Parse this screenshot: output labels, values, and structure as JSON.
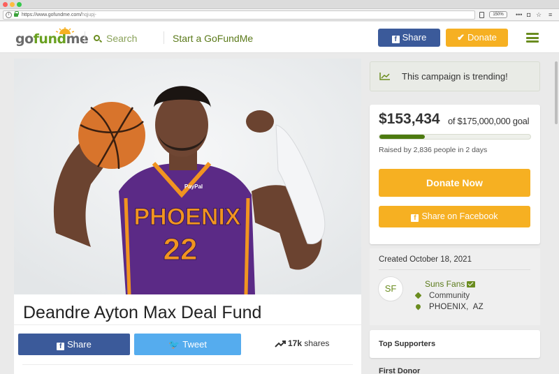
{
  "browser": {
    "url_host": "https://www.gofundme.com/",
    "url_path": "hqjupj-",
    "zoom": "150%",
    "icons": {
      "info": "info-icon",
      "lock": "lock-icon",
      "reader": "reader-view-icon",
      "more": "more-icon",
      "pocket": "pocket-icon",
      "bookmark": "star-icon",
      "menu": "hamburger-icon"
    }
  },
  "header": {
    "logo": {
      "go": "go",
      "fund": "fund",
      "me": "me"
    },
    "search_label": "Search",
    "start_label": "Start a GoFundMe",
    "share_label": "Share",
    "donate_label": "Donate",
    "colors": {
      "brand_green": "#6a8c1f",
      "facebook_blue": "#3b5a9a",
      "donate_yellow": "#f6b022"
    }
  },
  "campaign": {
    "title": "Deandre Ayton Max Deal Fund",
    "photo": {
      "jersey_team": "PHOENIX",
      "jersey_number": "22",
      "jersey_sponsor": "PayPal"
    },
    "share_fb_label": "Share",
    "tweet_label": "Tweet",
    "shares_count": "17k",
    "shares_label": "shares",
    "colors": {
      "twitter_blue": "#55acee"
    }
  },
  "sidebar": {
    "trending_text": "This campaign is trending!",
    "raised_amount": "$153,434",
    "goal_text": "of $175,000,000 goal",
    "progress_percent": 30,
    "raised_by_text": "Raised by 2,836 people in 2 days",
    "donate_now_label": "Donate Now",
    "share_facebook_label": "Share on Facebook",
    "created_text": "Created October 18, 2021",
    "organizer_initials": "SF",
    "organizer_name": "Suns Fans",
    "organizer_category": "Community",
    "organizer_location": "PHOENIX,  AZ",
    "top_supporters_label": "Top Supporters",
    "first_donor_label": "First Donor"
  }
}
